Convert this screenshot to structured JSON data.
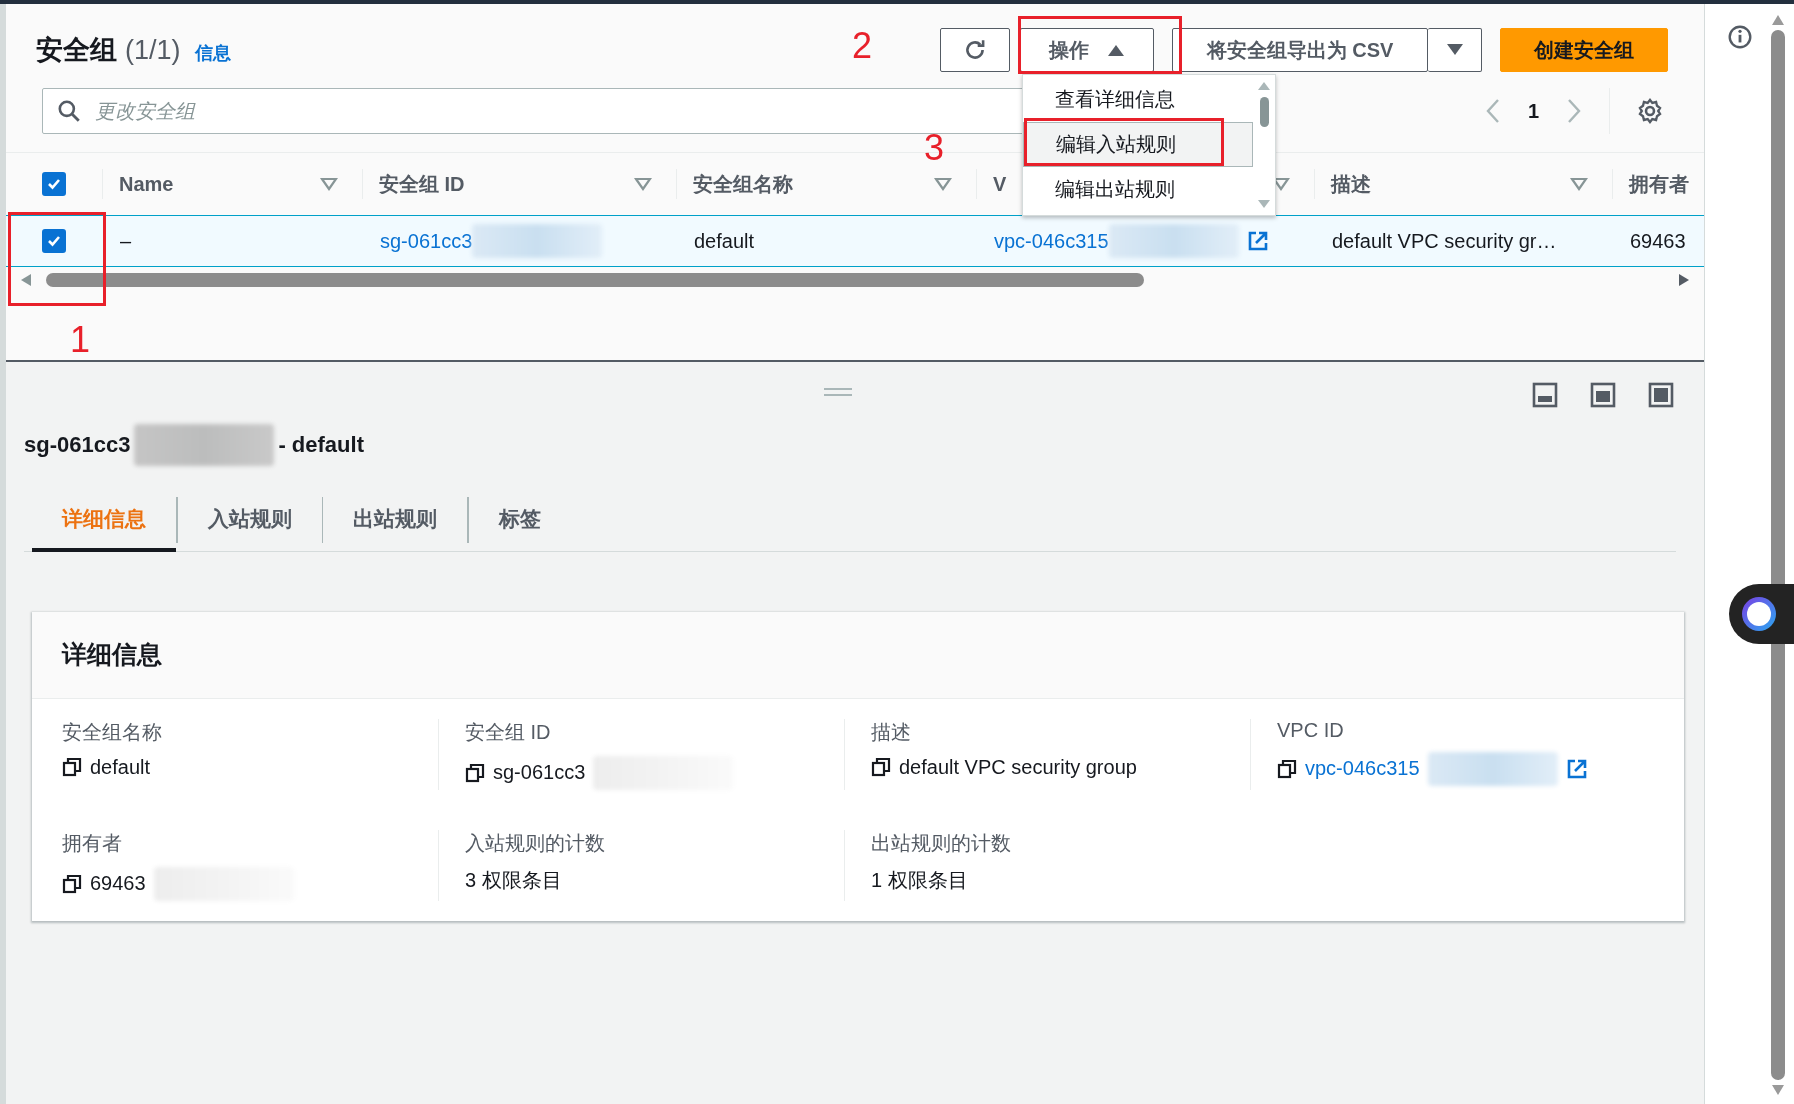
{
  "header": {
    "title": "安全组",
    "count": "(1/1)",
    "info_link": "信息"
  },
  "toolbar": {
    "actions_button": "操作",
    "actions_expanded": true,
    "export_button": "将安全组导出为 CSV",
    "create_button": "创建安全组"
  },
  "actions_menu": [
    {
      "label": "查看详细信息",
      "selected": false
    },
    {
      "label": "编辑入站规则",
      "selected": true
    },
    {
      "label": "编辑出站规则",
      "selected": false
    }
  ],
  "search": {
    "placeholder": "更改安全组"
  },
  "pagination": {
    "current_page": "1"
  },
  "table": {
    "select_all_checked": true,
    "columns": [
      "Name",
      "安全组 ID",
      "安全组名称",
      "V",
      "描述",
      "拥有者"
    ],
    "rows": [
      {
        "checked": true,
        "name": "–",
        "group_id": "sg-061cc3",
        "group_id_redacted": true,
        "group_name": "default",
        "vpc_id": "vpc-046c315",
        "vpc_id_redacted": true,
        "description": "default VPC security gr…",
        "owner": "69463"
      }
    ]
  },
  "detail": {
    "title_id": "sg-061cc3",
    "title_redacted": true,
    "title_suffix": "- default",
    "tabs": [
      {
        "label": "详细信息",
        "selected": true
      },
      {
        "label": "入站规则",
        "selected": false
      },
      {
        "label": "出站规则",
        "selected": false
      },
      {
        "label": "标签",
        "selected": false
      }
    ],
    "card_title": "详细信息",
    "fields": [
      {
        "label": "安全组名称",
        "value": "default",
        "copy": true,
        "link": false,
        "redacted": false,
        "external": false
      },
      {
        "label": "安全组 ID",
        "value": "sg-061cc3",
        "copy": true,
        "link": false,
        "redacted": true,
        "external": false
      },
      {
        "label": "描述",
        "value": "default VPC security group",
        "copy": true,
        "link": false,
        "redacted": false,
        "external": false
      },
      {
        "label": "VPC ID",
        "value": "vpc-046c315",
        "copy": true,
        "link": true,
        "redacted": true,
        "external": true
      },
      {
        "label": "拥有者",
        "value": "69463",
        "copy": true,
        "link": false,
        "redacted": true,
        "external": false
      },
      {
        "label": "入站规则的计数",
        "value": "3 权限条目",
        "copy": false,
        "link": false,
        "redacted": false,
        "external": false
      },
      {
        "label": "出站规则的计数",
        "value": "1 权限条目",
        "copy": false,
        "link": false,
        "redacted": false,
        "external": false
      }
    ]
  },
  "annotations": [
    {
      "label": "1"
    },
    {
      "label": "2"
    },
    {
      "label": "3"
    }
  ]
}
